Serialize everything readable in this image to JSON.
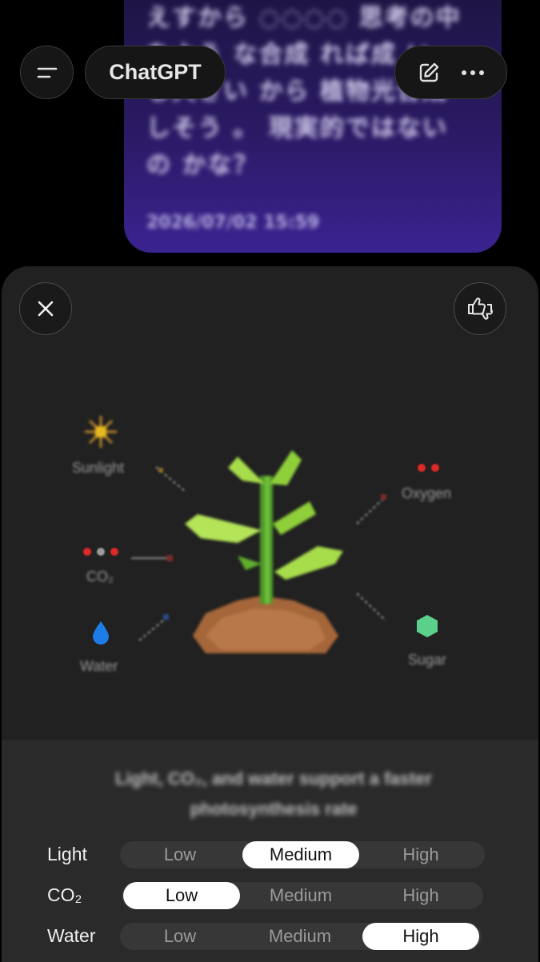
{
  "header": {
    "title": "ChatGPT"
  },
  "message": {
    "text": "えすから ◌◌◌◌ 思考の中をよう な合成 れば成 い し大きい から 植物光合成 しそう 。 現実的ではないの かな？",
    "timestamp": "2026/07/02 15:59"
  },
  "diagram": {
    "labels": {
      "sunlight": "Sunlight",
      "co2": "CO₂",
      "water": "Water",
      "oxygen": "Oxygen",
      "sugar": "Sugar"
    },
    "colors": {
      "sun": "#d9a51e",
      "co2_red": "#e02828",
      "co2_grey": "#9c9c9c",
      "water": "#1e7ce6",
      "sugar": "#5bd08a",
      "oxygen": "#e02828",
      "leaf": "#a7dd4a",
      "soil": "#a5663a"
    }
  },
  "caption": "Light, CO₂, and water support a faster photosynthesis rate",
  "controls": [
    {
      "label": "Light",
      "options": [
        "Low",
        "Medium",
        "High"
      ],
      "selected": "Medium"
    },
    {
      "label": "CO₂",
      "options": [
        "Low",
        "Medium",
        "High"
      ],
      "selected": "Low"
    },
    {
      "label": "Water",
      "options": [
        "Low",
        "Medium",
        "High"
      ],
      "selected": "High"
    }
  ]
}
